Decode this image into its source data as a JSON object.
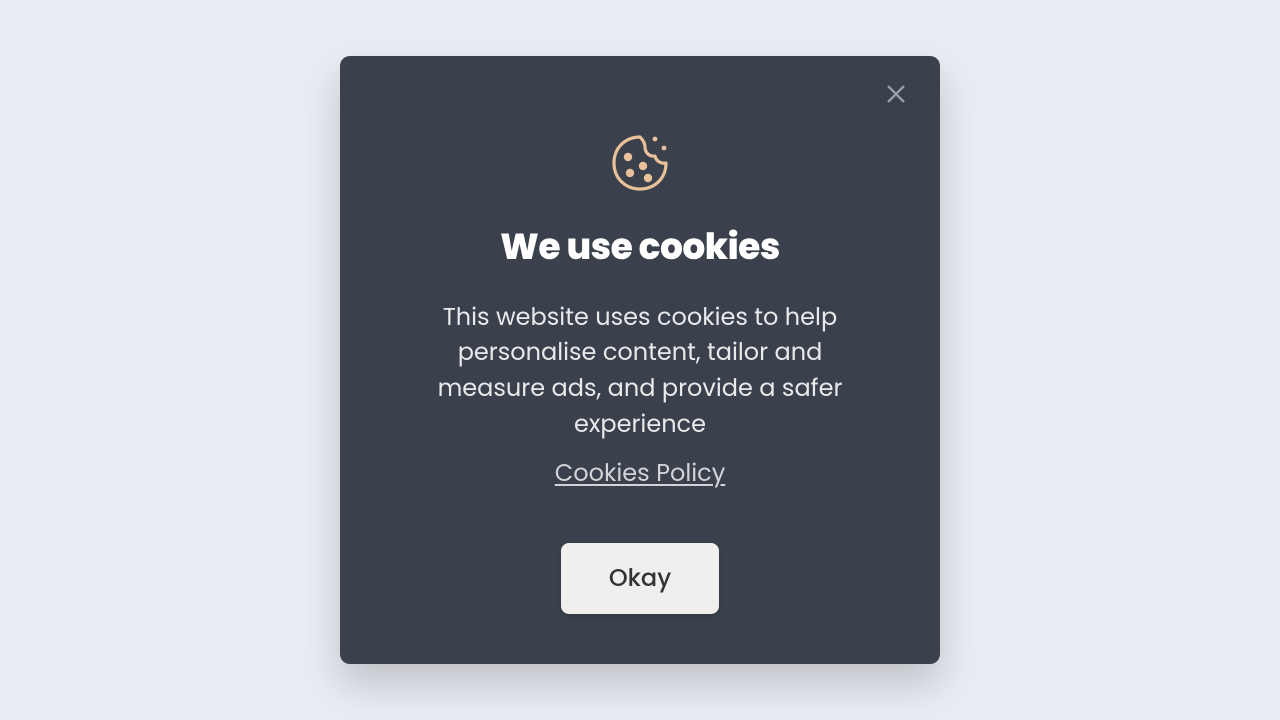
{
  "modal": {
    "title": "We use cookies",
    "description": "This website uses cookies to help personalise content, tailor and measure ads, and provide a safer experience",
    "policy_link_label": "Cookies Policy",
    "okay_button_label": "Okay",
    "icon_color": "#e8c19a",
    "background_color": "#3a414c"
  }
}
